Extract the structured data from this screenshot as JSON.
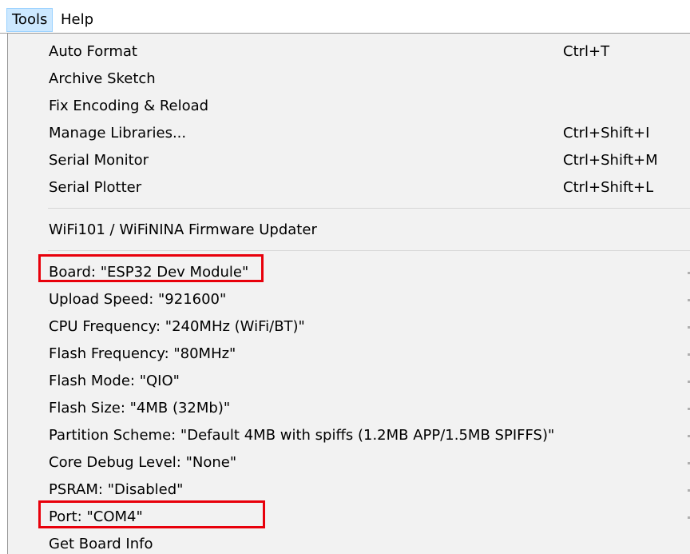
{
  "menubar": {
    "tools_label": "Tools",
    "help_label": "Help"
  },
  "menu": {
    "group1": [
      {
        "label": "Auto Format",
        "shortcut": "Ctrl+T"
      },
      {
        "label": "Archive Sketch",
        "shortcut": ""
      },
      {
        "label": "Fix Encoding & Reload",
        "shortcut": ""
      },
      {
        "label": "Manage Libraries...",
        "shortcut": "Ctrl+Shift+I"
      },
      {
        "label": "Serial Monitor",
        "shortcut": "Ctrl+Shift+M"
      },
      {
        "label": "Serial Plotter",
        "shortcut": "Ctrl+Shift+L"
      }
    ],
    "group2": [
      {
        "label": "WiFi101 / WiFiNINA Firmware Updater"
      }
    ],
    "group3": [
      {
        "label": "Board: \"ESP32 Dev Module\""
      },
      {
        "label": "Upload Speed: \"921600\""
      },
      {
        "label": "CPU Frequency: \"240MHz (WiFi/BT)\""
      },
      {
        "label": "Flash Frequency: \"80MHz\""
      },
      {
        "label": "Flash Mode: \"QIO\""
      },
      {
        "label": "Flash Size: \"4MB (32Mb)\""
      },
      {
        "label": "Partition Scheme: \"Default 4MB with spiffs (1.2MB APP/1.5MB SPIFFS)\""
      },
      {
        "label": "Core Debug Level: \"None\""
      },
      {
        "label": "PSRAM: \"Disabled\""
      },
      {
        "label": "Port: \"COM4\""
      },
      {
        "label": "Get Board Info"
      }
    ]
  },
  "annotations": {
    "highlight_color": "#e8000b",
    "highlighted_items": [
      "Board: \"ESP32 Dev Module\"",
      "Port: \"COM4\""
    ]
  }
}
